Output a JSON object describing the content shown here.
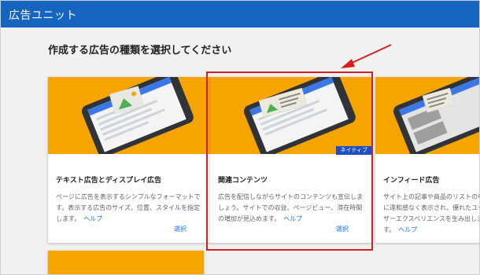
{
  "appbar": {
    "title": "広告ユニット"
  },
  "heading": "作成する広告の種類を選択してください",
  "cards": [
    {
      "title": "テキスト広告とディスプレイ広告",
      "desc": "ページに広告を表示するシンプルなフォーマットです。表示する広告のサイズ、位置、スタイルを指定します。",
      "help": "ヘルプ",
      "select": "選択"
    },
    {
      "title": "関連コンテンツ",
      "desc": "広告を配信しながらサイトのコンテンツも宣伝しましょう。サイトでの収益、ページビュー、滞在時間の増加が見込めます。",
      "help": "ヘルプ",
      "select": "選択",
      "badge": "ネイティブ"
    },
    {
      "title": "インフィード広告",
      "desc": "サイト上の記事や商品のリストの中に違和感なく表示され、優れたユーザーエクスペリエンスを生み出します。",
      "help": "ヘルプ",
      "select": ""
    }
  ],
  "colors": {
    "appbar": "#1565c0",
    "hero": "#f6a500",
    "link": "#1a73e8",
    "highlight": "#d81e1e",
    "badge": "#1e4fc2"
  },
  "icons": [
    "phone-illustration-icon",
    "arrow-annotation-icon"
  ]
}
